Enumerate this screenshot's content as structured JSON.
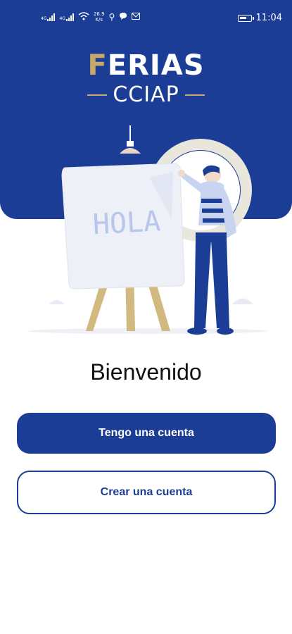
{
  "status_bar": {
    "network_1": "4G",
    "network_2": "4G",
    "speed_value": "26.9",
    "speed_unit": "K/s",
    "time": "11:04",
    "icons": [
      "signal-icon",
      "wifi-icon",
      "usb-icon",
      "chat-icon",
      "mail-icon",
      "battery-icon"
    ]
  },
  "logo": {
    "line1_accent": "F",
    "line1_rest": "ERIAS",
    "line2": "CCIAP"
  },
  "illustration": {
    "board_text": "HOLA"
  },
  "welcome": {
    "title": "Bienvenido"
  },
  "actions": {
    "login_label": "Tengo una cuenta",
    "register_label": "Crear una cuenta"
  },
  "colors": {
    "brand_blue": "#1b3d96",
    "accent_gold": "#c8a96a",
    "background": "#ffffff"
  }
}
